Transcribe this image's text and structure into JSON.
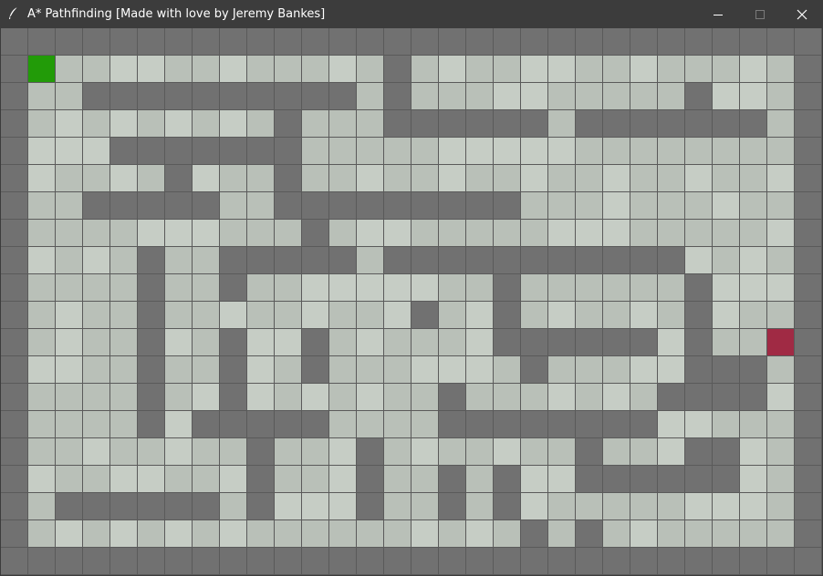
{
  "window": {
    "title": "A* Pathfinding [Made with love by Jeremy Bankes]",
    "icon": "feather-icon",
    "controls": [
      "minimize-icon",
      "maximize-icon",
      "close-icon"
    ]
  },
  "grid": {
    "rows": 20,
    "cols": 30,
    "legend": {
      "W": "wall",
      "G": "start",
      "R": "goal",
      ".": "open"
    },
    "colors": {
      "wall": "#717171",
      "open_a": "#b9c0b8",
      "open_b": "#c6cdc5",
      "start": "#229b08",
      "goal": "#a02a44",
      "grid_line": "#5a5a5a"
    },
    "cells": [
      "WWWWWWWWWWWWWWWWWWWWWWWWWWWWWW",
      "WG............W..............W",
      "W..WWWWWWWWWW.W..........W...W",
      "W.........W...WWWWWW.WWWWWWW.W",
      "W...WWWWWWW..................W",
      "W.....W...W..................W",
      "W..WWWWW..WWWWWWWWW..........W",
      "W..........W.................W",
      "W....W..WWWWW.WWWWWWWWWWW....W",
      "W....W..W.........W......W...W",
      "W....W.........W..W......W...W",
      "W....W..W..W......WWWWWW.W..RW",
      "W....W..W..W.......W.....WWW.W",
      "W....W..W.......W.......WWWW.W",
      "W....W.WWWWW....WWWWWWWW.....W",
      "W........W...W.......W...WW..W",
      "W........W...W..W.W..WWWWWW..W",
      "W.WWWWWW.W...W..W.W..........W",
      "W..................W.W.......W",
      "WWWWWWWWWWWWWWWWWWWWWWWWWWWWWW"
    ]
  }
}
